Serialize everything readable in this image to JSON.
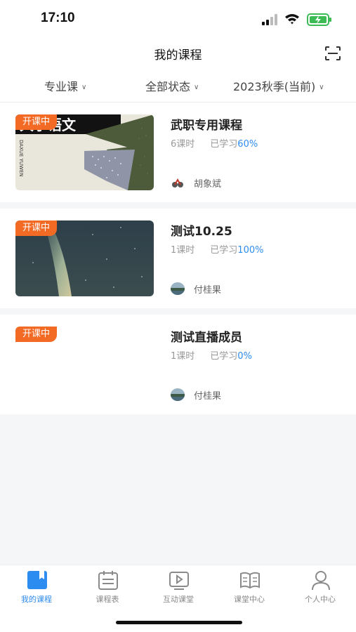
{
  "status_bar": {
    "time": "17:10"
  },
  "nav": {
    "title": "我的课程",
    "scan_icon": "scan-icon"
  },
  "filters": [
    {
      "label": "专业课"
    },
    {
      "label": "全部状态"
    },
    {
      "label": "2023秋季(当前)"
    }
  ],
  "courses": [
    {
      "badge": "开课中",
      "title": "武职专用课程",
      "lessons": "6课时",
      "progress_label": "已学习",
      "progress": "60%",
      "teacher": "胡象斌",
      "thumbnail": "大学语文 textbook cover",
      "cover_text": "大学语文",
      "cover_side_text": "DAXUE YUWEN"
    },
    {
      "badge": "开课中",
      "title": "测试10.25",
      "lessons": "1课时",
      "progress_label": "已学习",
      "progress": "100%",
      "teacher": "付桂果",
      "thumbnail": "aurora night sky"
    },
    {
      "badge": "开课中",
      "title": "测试直播成员",
      "lessons": "1课时",
      "progress_label": "已学习",
      "progress": "0%",
      "teacher": "付桂果",
      "thumbnail": ""
    }
  ],
  "tabs": [
    {
      "label": "我的课程",
      "icon": "bookmark-book-icon",
      "active": true
    },
    {
      "label": "课程表",
      "icon": "calendar-icon",
      "active": false
    },
    {
      "label": "互动课堂",
      "icon": "video-play-icon",
      "active": false
    },
    {
      "label": "课堂中心",
      "icon": "open-book-icon",
      "active": false
    },
    {
      "label": "个人中心",
      "icon": "person-icon",
      "active": false
    }
  ],
  "colors": {
    "accent": "#2d8cf0",
    "badge": "#f26a24"
  }
}
